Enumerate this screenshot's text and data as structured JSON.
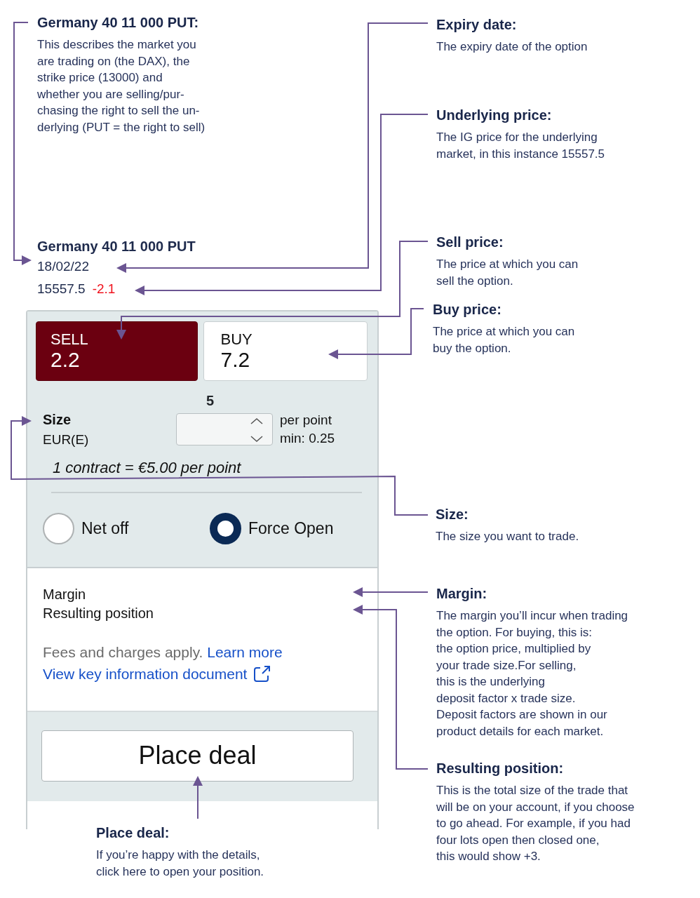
{
  "annotations": [
    {
      "title": "Germany 40 11 000 PUT:",
      "text": "This describes the market you\nare trading on (the DAX), the\nstrike price (13000) and\nwhether you are selling/pur-\nchasing the right to sell the un-\nderlying (PUT = the right to sell)"
    },
    {
      "title": "Expiry date:",
      "text": "The expiry date of the option"
    },
    {
      "title": "Underlying price:",
      "text": "The IG price for the underlying\nmarket, in this instance 15557.5"
    },
    {
      "title": "Sell price:",
      "text": "The price at which you can\nsell the option."
    },
    {
      "title": "Buy price:",
      "text": "The price at which you can\nbuy the option."
    },
    {
      "title": "Size:",
      "text": "The size you want to trade."
    },
    {
      "title": "Margin:",
      "text": "The margin you’ll incur when trading\nthe option. For buying, this is:\nthe option price, multiplied by\nyour trade size.For selling,\nthis is the underlying\ndeposit factor x trade size.\nDeposit factors are shown in our\nproduct details for each market."
    },
    {
      "title": "Resulting position:",
      "text": "This is the total size of the trade that\nwill be on your account, if you choose\nto go ahead. For example, if you had\nfour lots open then closed one,\nthis would show +3."
    },
    {
      "title": "Place deal:",
      "text": "If you’re happy with the details,\nclick here to open your position."
    }
  ],
  "ticket": {
    "market": "Germany 40 11 000 PUT",
    "expiry": "18/02/22",
    "price": "15557.5",
    "change": "-2.1",
    "sides": [
      {
        "label": "SELL",
        "price": "2.2",
        "selected": true
      },
      {
        "label": "BUY",
        "price": "7.2",
        "selected": false
      }
    ],
    "size_value": "5",
    "size_label": "Size",
    "currency": "EUR(E)",
    "unit": "per point",
    "min": "min: 0.25",
    "contract_note": "1 contract = €5.00 per point",
    "radios": [
      {
        "label": "Net off",
        "selected": false
      },
      {
        "label": "Force Open",
        "selected": true
      }
    ],
    "summary": [
      "Margin",
      "Resulting position"
    ],
    "fees": "Fees and charges apply.",
    "learn_more": "Learn more",
    "kid_link": "View key information document",
    "place_deal": "Place deal"
  }
}
